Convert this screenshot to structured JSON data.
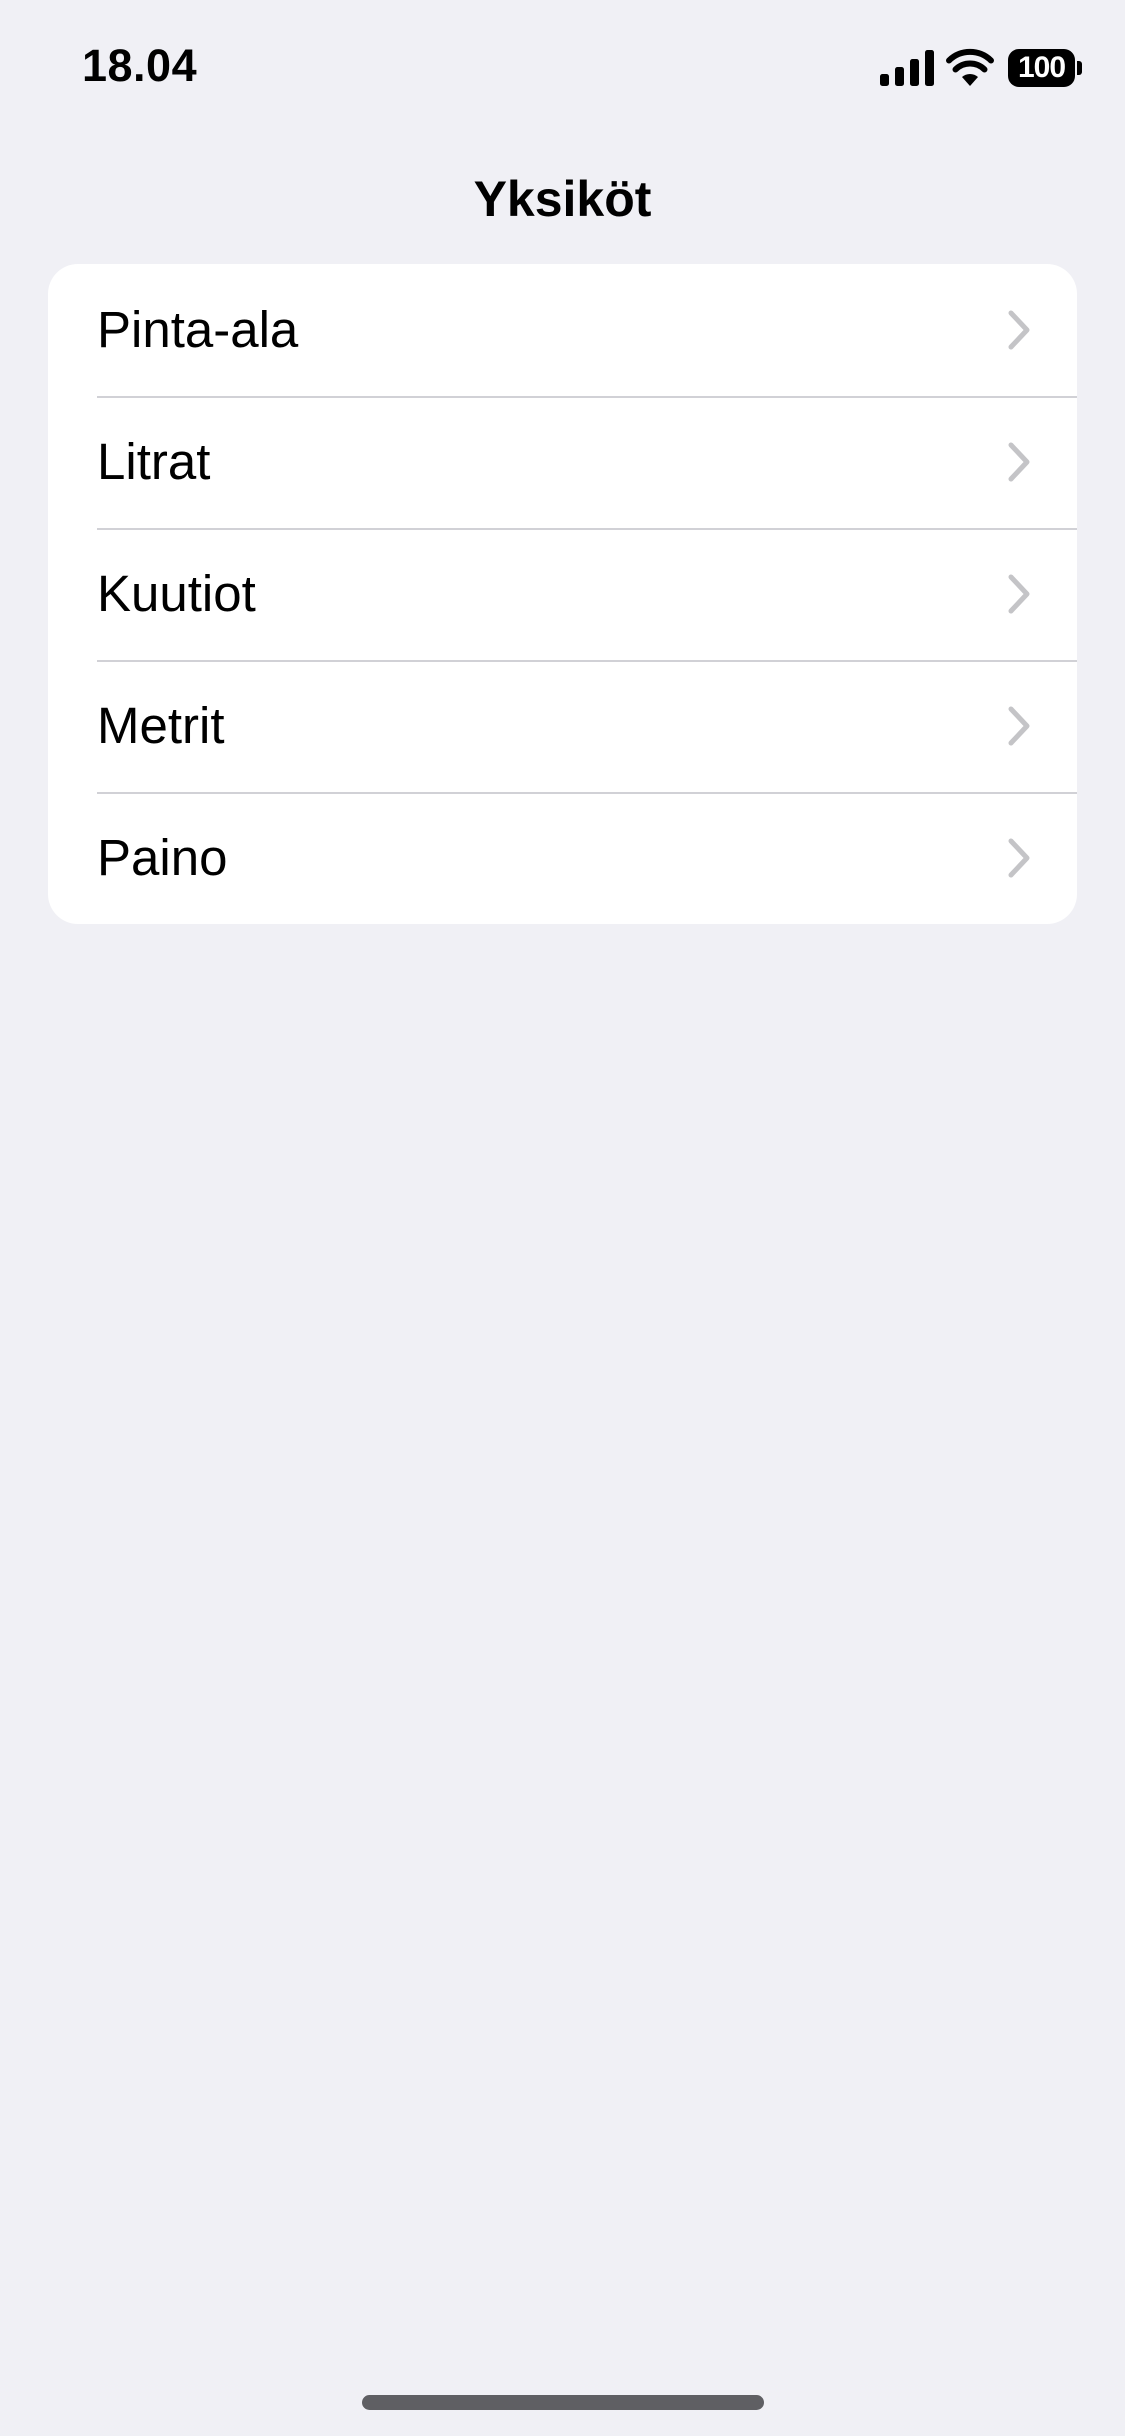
{
  "status_bar": {
    "time": "18.04",
    "battery_level": "100",
    "icons": [
      "signal-icon",
      "wifi-icon",
      "battery-icon"
    ]
  },
  "nav": {
    "title": "Yksiköt"
  },
  "list": {
    "items": [
      {
        "label": "Pinta-ala",
        "icon": "chevron-right-icon"
      },
      {
        "label": "Litrat",
        "icon": "chevron-right-icon"
      },
      {
        "label": "Kuutiot",
        "icon": "chevron-right-icon"
      },
      {
        "label": "Metrit",
        "icon": "chevron-right-icon"
      },
      {
        "label": "Paino",
        "icon": "chevron-right-icon"
      }
    ]
  },
  "colors": {
    "background": "#f0f0f5",
    "card": "#ffffff",
    "separator": "#d1d1d6",
    "chevron": "#c4c4c7",
    "text": "#000000"
  }
}
